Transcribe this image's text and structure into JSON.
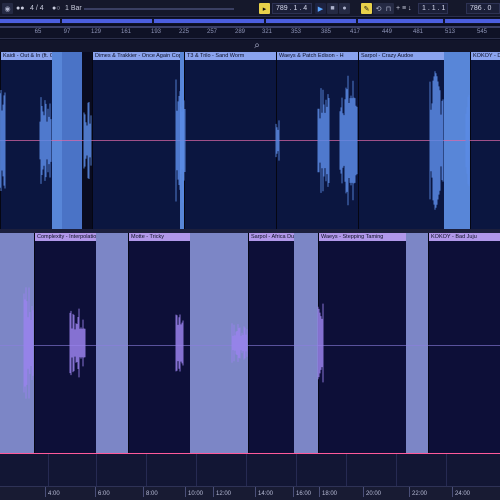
{
  "transport": {
    "time_signature": "4 / 4",
    "quantize": "1 Bar",
    "arrangement_position": "789 .  1 .  4",
    "loop_start": "1 .  1 .  1",
    "loop_length": "786 .  0"
  },
  "ruler": {
    "bars": [
      "65",
      "97",
      "129",
      "161",
      "193",
      "225",
      "257",
      "289",
      "321",
      "353",
      "385",
      "417",
      "449",
      "481",
      "513",
      "545"
    ]
  },
  "lane1": {
    "clips": [
      {
        "name": "Kaidi - Out & In (ft. Chimpo)"
      },
      {
        "name": "Dimes & Trakkier - Once Again Copy"
      },
      {
        "name": "T3 & Trilo - Sand Worm"
      },
      {
        "name": "Waeys & Patch Edison - H"
      },
      {
        "name": "Sarpol - Crazy Audoe"
      },
      {
        "name": "KOKOY - Deha"
      }
    ]
  },
  "lane2": {
    "clips": [
      {
        "name": ""
      },
      {
        "name": "Complexity - Interpolation"
      },
      {
        "name": "Motte - Tricky"
      },
      {
        "name": "Sarpol - Africa Dub"
      },
      {
        "name": "Waeys - Stepping Taming"
      },
      {
        "name": "KOKOY - Bad Juju"
      }
    ]
  },
  "time_ruler": {
    "labels": [
      "4:00",
      "6:00",
      "8:00",
      "10:00",
      "12:00",
      "14:00",
      "16:00",
      "18:00",
      "20:00",
      "22:00",
      "24:00"
    ]
  },
  "colors": {
    "lane1_accent": "#5886d8",
    "lane2_accent": "#7c86c6",
    "marker": "#ff5a9a",
    "play": "#5aa6ff",
    "metronome": "#e8d14a"
  }
}
